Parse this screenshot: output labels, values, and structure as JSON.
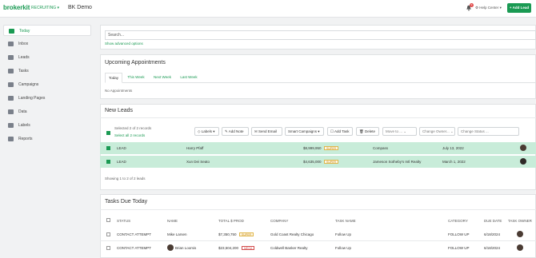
{
  "header": {
    "logo": "brokerkit",
    "product": "RECRUITING",
    "account": "BK Demo",
    "notifications": "9",
    "help": "Help Center",
    "add_lead": "+ Add Lead"
  },
  "sidebar": {
    "items": [
      {
        "label": "Today",
        "icon": "calendar-icon"
      },
      {
        "label": "Inbox",
        "icon": "inbox-icon"
      },
      {
        "label": "Leads",
        "icon": "leads-icon"
      },
      {
        "label": "Tasks",
        "icon": "tasks-icon"
      },
      {
        "label": "Campaigns",
        "icon": "megaphone-icon"
      },
      {
        "label": "Landing Pages",
        "icon": "landing-page-icon"
      },
      {
        "label": "Data",
        "icon": "data-icon"
      },
      {
        "label": "Labels",
        "icon": "tag-icon"
      },
      {
        "label": "Reports",
        "icon": "chart-icon"
      }
    ]
  },
  "search": {
    "placeholder": "Search...",
    "advanced": "Show advanced options"
  },
  "appointments": {
    "title": "Upcoming Appointments",
    "tabs": [
      "Today",
      "This Week",
      "Next Week",
      "Last Week"
    ],
    "empty": "No Appointments"
  },
  "new_leads": {
    "title": "New Leads",
    "selected": "Selected 2 of 2 records",
    "select_all": "Select all 2 records",
    "toolbar": {
      "labels": "Labels",
      "add_note": "Add Note",
      "send_email": "Send Email",
      "smart_campaigns": "Smart Campaigns",
      "add_task": "Add Task",
      "delete": "Delete",
      "move_to": "Move to ...",
      "change_owner": "Change Owner...",
      "change_status": "Change Status ..."
    },
    "rows": [
      {
        "status": "LEAD",
        "name": "Harry Pfaff",
        "prod": "$8,999,950",
        "tag": "SUPER",
        "company": "Compass",
        "date": "July 13, 2022"
      },
      {
        "status": "LEAD",
        "name": "Xun Dei Seato",
        "prod": "$4,635,000",
        "tag": "SUPER",
        "company": "Jameson Sotheby's Intl Realty",
        "date": "March 1, 2022"
      }
    ],
    "footer": "Showing 1 to 2 of 2 leads"
  },
  "tasks": {
    "title": "Tasks Due Today",
    "columns": [
      "STATUS",
      "NAME",
      "TOTAL $ PROD",
      "COMPANY",
      "TASK NAME",
      "CATEGORY",
      "DUE DATE",
      "TASK OWNER"
    ],
    "rows": [
      {
        "status": "CONTACT ATTEMPT",
        "name": "Mike Larsen",
        "prod": "$7,350,750",
        "tag": "SUPER",
        "company": "Gold Coast Realty Chicago",
        "task": "Follow Up",
        "category": "FOLLOW UP",
        "due": "6/18/2024"
      },
      {
        "status": "CONTACT ATTEMPT",
        "name": "Brian Loomis",
        "prod": "$23,504,200",
        "tag": "MEGA",
        "company": "Coldwell Banker Realty",
        "task": "Follow Up",
        "category": "FOLLOW UP",
        "due": "6/18/2024"
      }
    ]
  },
  "colors": {
    "brand": "#1a9a53",
    "selected_row": "#c8ecd9"
  }
}
